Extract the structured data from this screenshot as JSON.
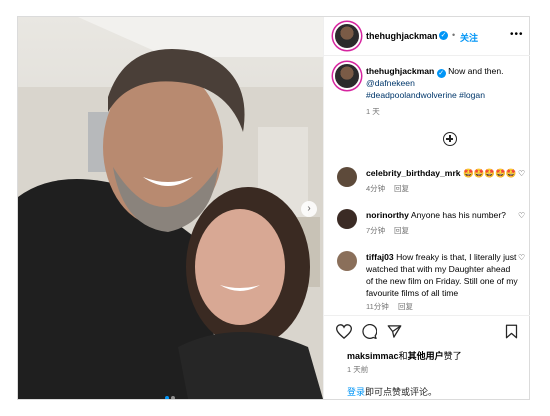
{
  "post": {
    "author": "thehughjackman",
    "follow_label": "关注",
    "more_label": "•••",
    "separator": "•",
    "caption_text": "Now and then.",
    "caption_mention": "@dafnekeen",
    "caption_tags": "#deadpoolandwolverine #logan",
    "caption_age": "1 天",
    "comments": [
      {
        "user": "celebrity_birthday_mrk",
        "text": "🤩🤩🤩🤩🤩",
        "age": "4分钟",
        "reply": "回复"
      },
      {
        "user": "norinorthy",
        "text": "Anyone has his number?",
        "age": "7分钟",
        "reply": "回复"
      },
      {
        "user": "tiffaj03",
        "text": "How freaky is that, I literally just watched that with my Daughter ahead of the new film on Friday. Still one of my favourite films of all time",
        "age": "11分钟",
        "reply": "回复"
      }
    ],
    "likes_user": "maksimmac",
    "likes_mid": "和",
    "likes_others": "其他用户",
    "likes_end": "赞了",
    "post_age": "1 天前",
    "login_link": "登录",
    "login_rest": "即可点赞或评论。",
    "carousel_next": "›"
  },
  "colors": {
    "accent": "#0095f6",
    "muted": "#737373",
    "border": "#dbdbdb"
  }
}
